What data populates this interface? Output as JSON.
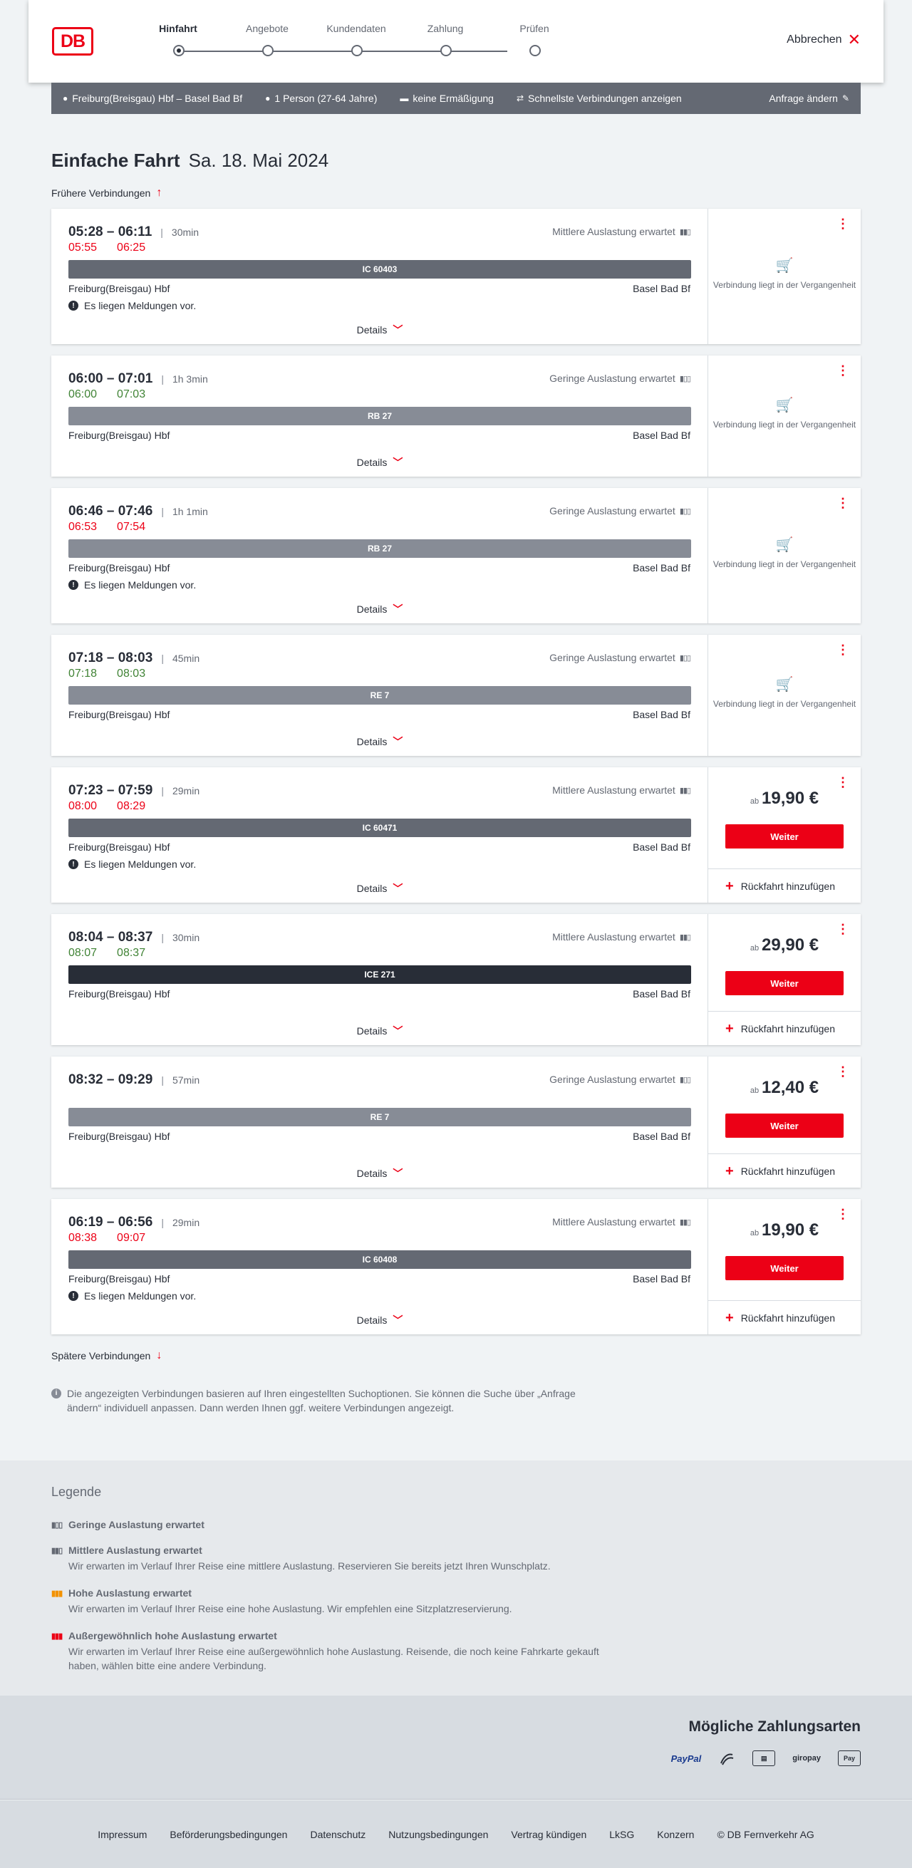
{
  "header": {
    "logo": "DB",
    "steps": [
      "Hinfahrt",
      "Angebote",
      "Kundendaten",
      "Zahlung",
      "Prüfen"
    ],
    "cancel_label": "Abbrechen"
  },
  "query": {
    "route": "Freiburg(Breisgau) Hbf – Basel Bad Bf",
    "passengers": "1 Person (27-64 Jahre)",
    "discount": "keine Ermäßigung",
    "fastest": "Schnellste Verbindungen anzeigen",
    "change": "Anfrage ändern"
  },
  "page": {
    "title_bold": "Einfache Fahrt",
    "title_date": "Sa. 18. Mai 2024",
    "earlier": "Frühere Verbindungen",
    "later": "Spätere Verbindungen",
    "details_label": "Details",
    "past_text": "Verbindung liegt in der Vergangenheit",
    "price_prefix": "ab",
    "weiter_label": "Weiter",
    "return_label": "Rückfahrt hinzufügen",
    "notice_text": "Es liegen Meldungen vor.",
    "info_text": "Die angezeigten Verbindungen basieren auf Ihren eingestellten Suchoptionen. Sie können die Suche über „Anfrage ändern“ individuell anpassen. Dann werden Ihnen ggf. weitere Verbindungen angezeigt."
  },
  "connections": [
    {
      "time": "05:28 – 06:11",
      "duration": "30min",
      "occupancy": "Mittlere Auslastung erwartet",
      "rt_dep": "05:55",
      "rt_arr": "06:25",
      "rt_status": "late",
      "train": "IC 60403",
      "train_color": "#646973",
      "from": "Freiburg(Breisgau) Hbf",
      "to": "Basel Bad Bf",
      "notice": true,
      "past": true
    },
    {
      "time": "06:00 – 07:01",
      "duration": "1h 3min",
      "occupancy": "Geringe Auslastung erwartet",
      "rt_dep": "06:00",
      "rt_arr": "07:03",
      "rt_status": "ontime",
      "train": "RB 27",
      "train_color": "#878c96",
      "from": "Freiburg(Breisgau) Hbf",
      "to": "Basel Bad Bf",
      "notice": false,
      "past": true
    },
    {
      "time": "06:46 – 07:46",
      "duration": "1h 1min",
      "occupancy": "Geringe Auslastung erwartet",
      "rt_dep": "06:53",
      "rt_arr": "07:54",
      "rt_status": "late",
      "train": "RB 27",
      "train_color": "#878c96",
      "from": "Freiburg(Breisgau) Hbf",
      "to": "Basel Bad Bf",
      "notice": true,
      "past": true
    },
    {
      "time": "07:18 – 08:03",
      "duration": "45min",
      "occupancy": "Geringe Auslastung erwartet",
      "rt_dep": "07:18",
      "rt_arr": "08:03",
      "rt_status": "ontime",
      "train": "RE 7",
      "train_color": "#878c96",
      "from": "Freiburg(Breisgau) Hbf",
      "to": "Basel Bad Bf",
      "notice": false,
      "past": true
    },
    {
      "time": "07:23 – 07:59",
      "duration": "29min",
      "occupancy": "Mittlere Auslastung erwartet",
      "rt_dep": "08:00",
      "rt_arr": "08:29",
      "rt_status": "late",
      "train": "IC 60471",
      "train_color": "#646973",
      "from": "Freiburg(Breisgau) Hbf",
      "to": "Basel Bad Bf",
      "notice": true,
      "past": false,
      "price": "19,90 €"
    },
    {
      "time": "08:04 – 08:37",
      "duration": "30min",
      "occupancy": "Mittlere Auslastung erwartet",
      "rt_dep": "08:07",
      "rt_arr": "08:37",
      "rt_status": "ontime",
      "train": "ICE 271",
      "train_color": "#282d37",
      "from": "Freiburg(Breisgau) Hbf",
      "to": "Basel Bad Bf",
      "notice": false,
      "past": false,
      "price": "29,90 €"
    },
    {
      "time": "08:32 – 09:29",
      "duration": "57min",
      "occupancy": "Geringe Auslastung erwartet",
      "rt_dep": "",
      "rt_arr": "",
      "rt_status": "none",
      "train": "RE 7",
      "train_color": "#878c96",
      "from": "Freiburg(Breisgau) Hbf",
      "to": "Basel Bad Bf",
      "notice": false,
      "past": false,
      "price": "12,40 €"
    },
    {
      "time": "06:19 – 06:56",
      "duration": "29min",
      "occupancy": "Mittlere Auslastung erwartet",
      "rt_dep": "08:38",
      "rt_arr": "09:07",
      "rt_status": "late",
      "train": "IC 60408",
      "train_color": "#646973",
      "from": "Freiburg(Breisgau) Hbf",
      "to": "Basel Bad Bf",
      "notice": true,
      "past": false,
      "price": "19,90 €"
    }
  ],
  "legend": {
    "title": "Legende",
    "items": [
      {
        "head": "Geringe Auslastung erwartet",
        "desc": "",
        "color": "#646973"
      },
      {
        "head": "Mittlere Auslastung erwartet",
        "desc": "Wir erwarten im Verlauf Ihrer Reise eine mittlere Auslastung. Reservieren Sie bereits jetzt Ihren Wunschplatz.",
        "color": "#646973"
      },
      {
        "head": "Hohe Auslastung erwartet",
        "desc": "Wir erwarten im Verlauf Ihrer Reise eine hohe Auslastung. Wir empfehlen eine Sitzplatzreservierung.",
        "color": "#f39200"
      },
      {
        "head": "Außergewöhnlich hohe Auslastung erwartet",
        "desc": "Wir erwarten im Verlauf Ihrer Reise eine außergewöhnlich hohe Auslastung. Reisende, die noch keine Fahrkarte gekauft haben, wählen bitte eine andere Verbindung.",
        "color": "#ec0016"
      }
    ]
  },
  "payment": {
    "title": "Mögliche Zahlungsarten",
    "methods": [
      "PayPal",
      "giropay",
      "Pay"
    ]
  },
  "footer": {
    "links": [
      "Impressum",
      "Beförderungsbedingungen",
      "Datenschutz",
      "Nutzungsbedingungen",
      "Vertrag kündigen",
      "LkSG",
      "Konzern",
      "© DB Fernverkehr AG"
    ]
  }
}
